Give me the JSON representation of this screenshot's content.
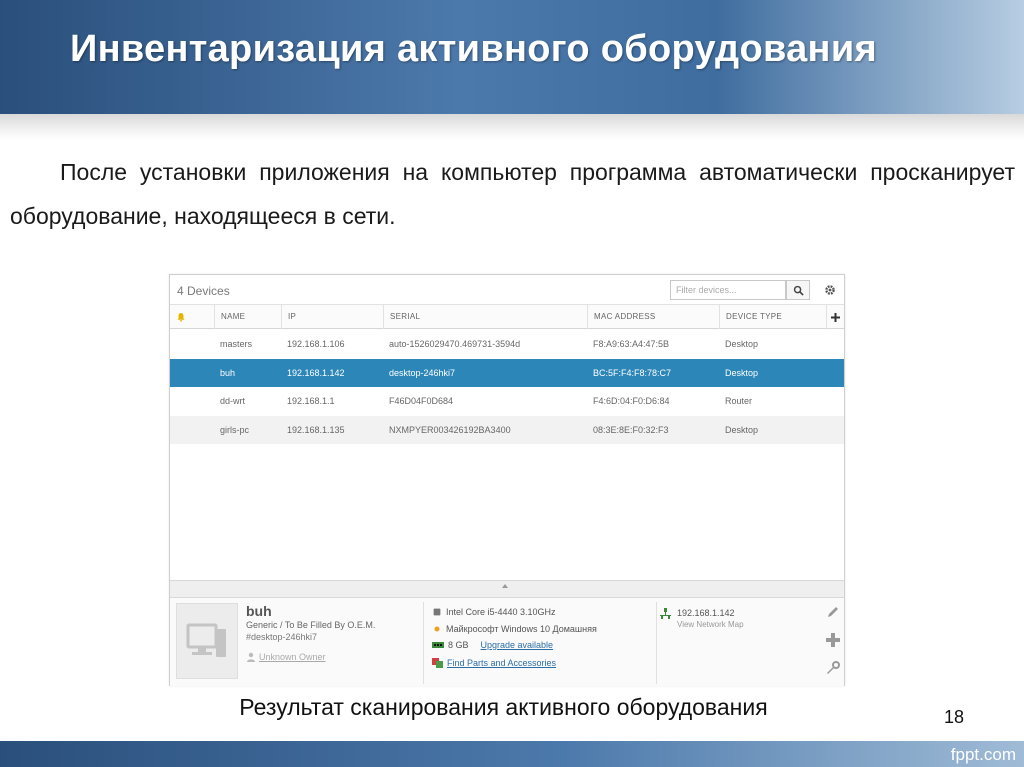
{
  "slide": {
    "title": "Инвентаризация активного оборудования",
    "body": "После установки приложения на компьютер программа автоматически просканирует оборудование, находящееся в сети.",
    "caption": "Результат сканирования активного оборудования",
    "page_number": "18",
    "brand": "fppt.com"
  },
  "app": {
    "device_count": "4 Devices",
    "filter_placeholder": "Filter devices...",
    "columns": [
      "NAME",
      "IP",
      "SERIAL",
      "MAC ADDRESS",
      "DEVICE TYPE"
    ],
    "devices": [
      {
        "name": "masters",
        "ip": "192.168.1.106",
        "serial": "auto-1526029470.469731-3594d",
        "mac": "F8:A9:63:A4:47:5B",
        "type": "Desktop"
      },
      {
        "name": "buh",
        "ip": "192.168.1.142",
        "serial": "desktop-246hki7",
        "mac": "BC:5F:F4:F8:78:C7",
        "type": "Desktop"
      },
      {
        "name": "dd-wrt",
        "ip": "192.168.1.1",
        "serial": "F46D04F0D684",
        "mac": "F4:6D:04:F0:D6:84",
        "type": "Router"
      },
      {
        "name": "girls-pc",
        "ip": "192.168.1.135",
        "serial": "NXMPYER003426192BA3400",
        "mac": "08:3E:8E:F0:32:F3",
        "type": "Desktop"
      }
    ],
    "selected_index": 1,
    "detail": {
      "name": "buh",
      "model": "Generic / To Be Filled By O.E.M.",
      "tag": "#desktop-246hki7",
      "owner": "Unknown Owner",
      "cpu": "Intel Core i5-4440 3.10GHz",
      "os": "Майкрософт Windows 10 Домашняя",
      "ram": "8 GB",
      "upgrade_link": "Upgrade available",
      "parts_link": "Find Parts and Accessories",
      "ip": "192.168.1.142",
      "network_map_link": "View Network Map"
    }
  },
  "colors": {
    "header_blue": "#4c79ab",
    "selected_row": "#2c86b8",
    "link": "#2b6ea6"
  },
  "icons": [
    "bell-icon",
    "search-icon",
    "gear-icon",
    "plus-icon",
    "computer-icon",
    "person-icon",
    "cpu-icon",
    "windows-icon",
    "ram-icon",
    "parts-icon",
    "network-icon",
    "edit-icon",
    "wrench-icon"
  ]
}
